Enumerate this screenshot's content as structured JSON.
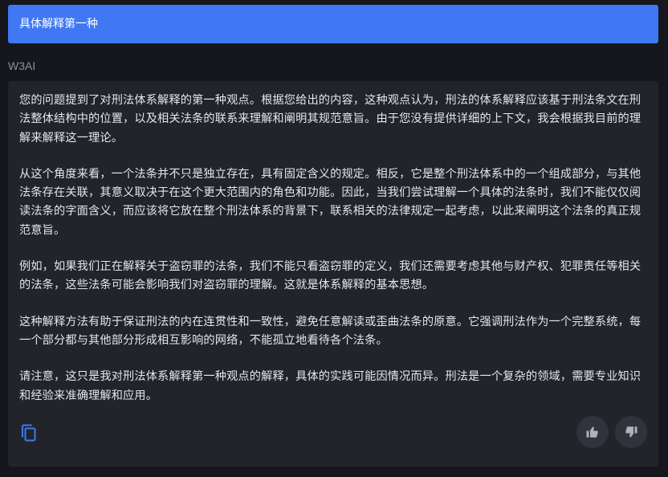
{
  "question": {
    "text": "具体解释第一种"
  },
  "bot": {
    "name": "W3AI"
  },
  "answer": {
    "paragraphs": [
      "您的问题提到了对刑法体系解释的第一种观点。根据您给出的内容，这种观点认为，刑法的体系解释应该基于刑法条文在刑法整体结构中的位置，以及相关法条的联系来理解和阐明其规范意旨。由于您没有提供详细的上下文，我会根据我目前的理解来解释这一理论。",
      "从这个角度来看，一个法条并不只是独立存在，具有固定含义的规定。相反，它是整个刑法体系中的一个组成部分，与其他法条存在关联，其意义取决于在这个更大范围内的角色和功能。因此，当我们尝试理解一个具体的法条时，我们不能仅仅阅读法条的字面含义，而应该将它放在整个刑法体系的背景下，联系相关的法律规定一起考虑，以此来阐明这个法条的真正规范意旨。",
      "例如，如果我们正在解释关于盗窃罪的法条，我们不能只看盗窃罪的定义，我们还需要考虑其他与财产权、犯罪责任等相关的法条，这些法条可能会影响我们对盗窃罪的理解。这就是体系解释的基本思想。",
      "这种解释方法有助于保证刑法的内在连贯性和一致性，避免任意解读或歪曲法条的原意。它强调刑法作为一个完整系统，每一个部分都与其他部分形成相互影响的网络，不能孤立地看待各个法条。",
      "请注意，这只是我对刑法体系解释第一种观点的解释，具体的实践可能因情况而异。刑法是一个复杂的领域，需要专业知识和经验来准确理解和应用。"
    ]
  },
  "actions": {
    "copy_icon": "copy-icon",
    "like_icon": "thumbs-up-icon",
    "dislike_icon": "thumbs-down-icon"
  },
  "colors": {
    "accent": "#3f78f2",
    "background": "#16171c",
    "card": "#22242a",
    "icon_blue": "#3f78f2"
  }
}
